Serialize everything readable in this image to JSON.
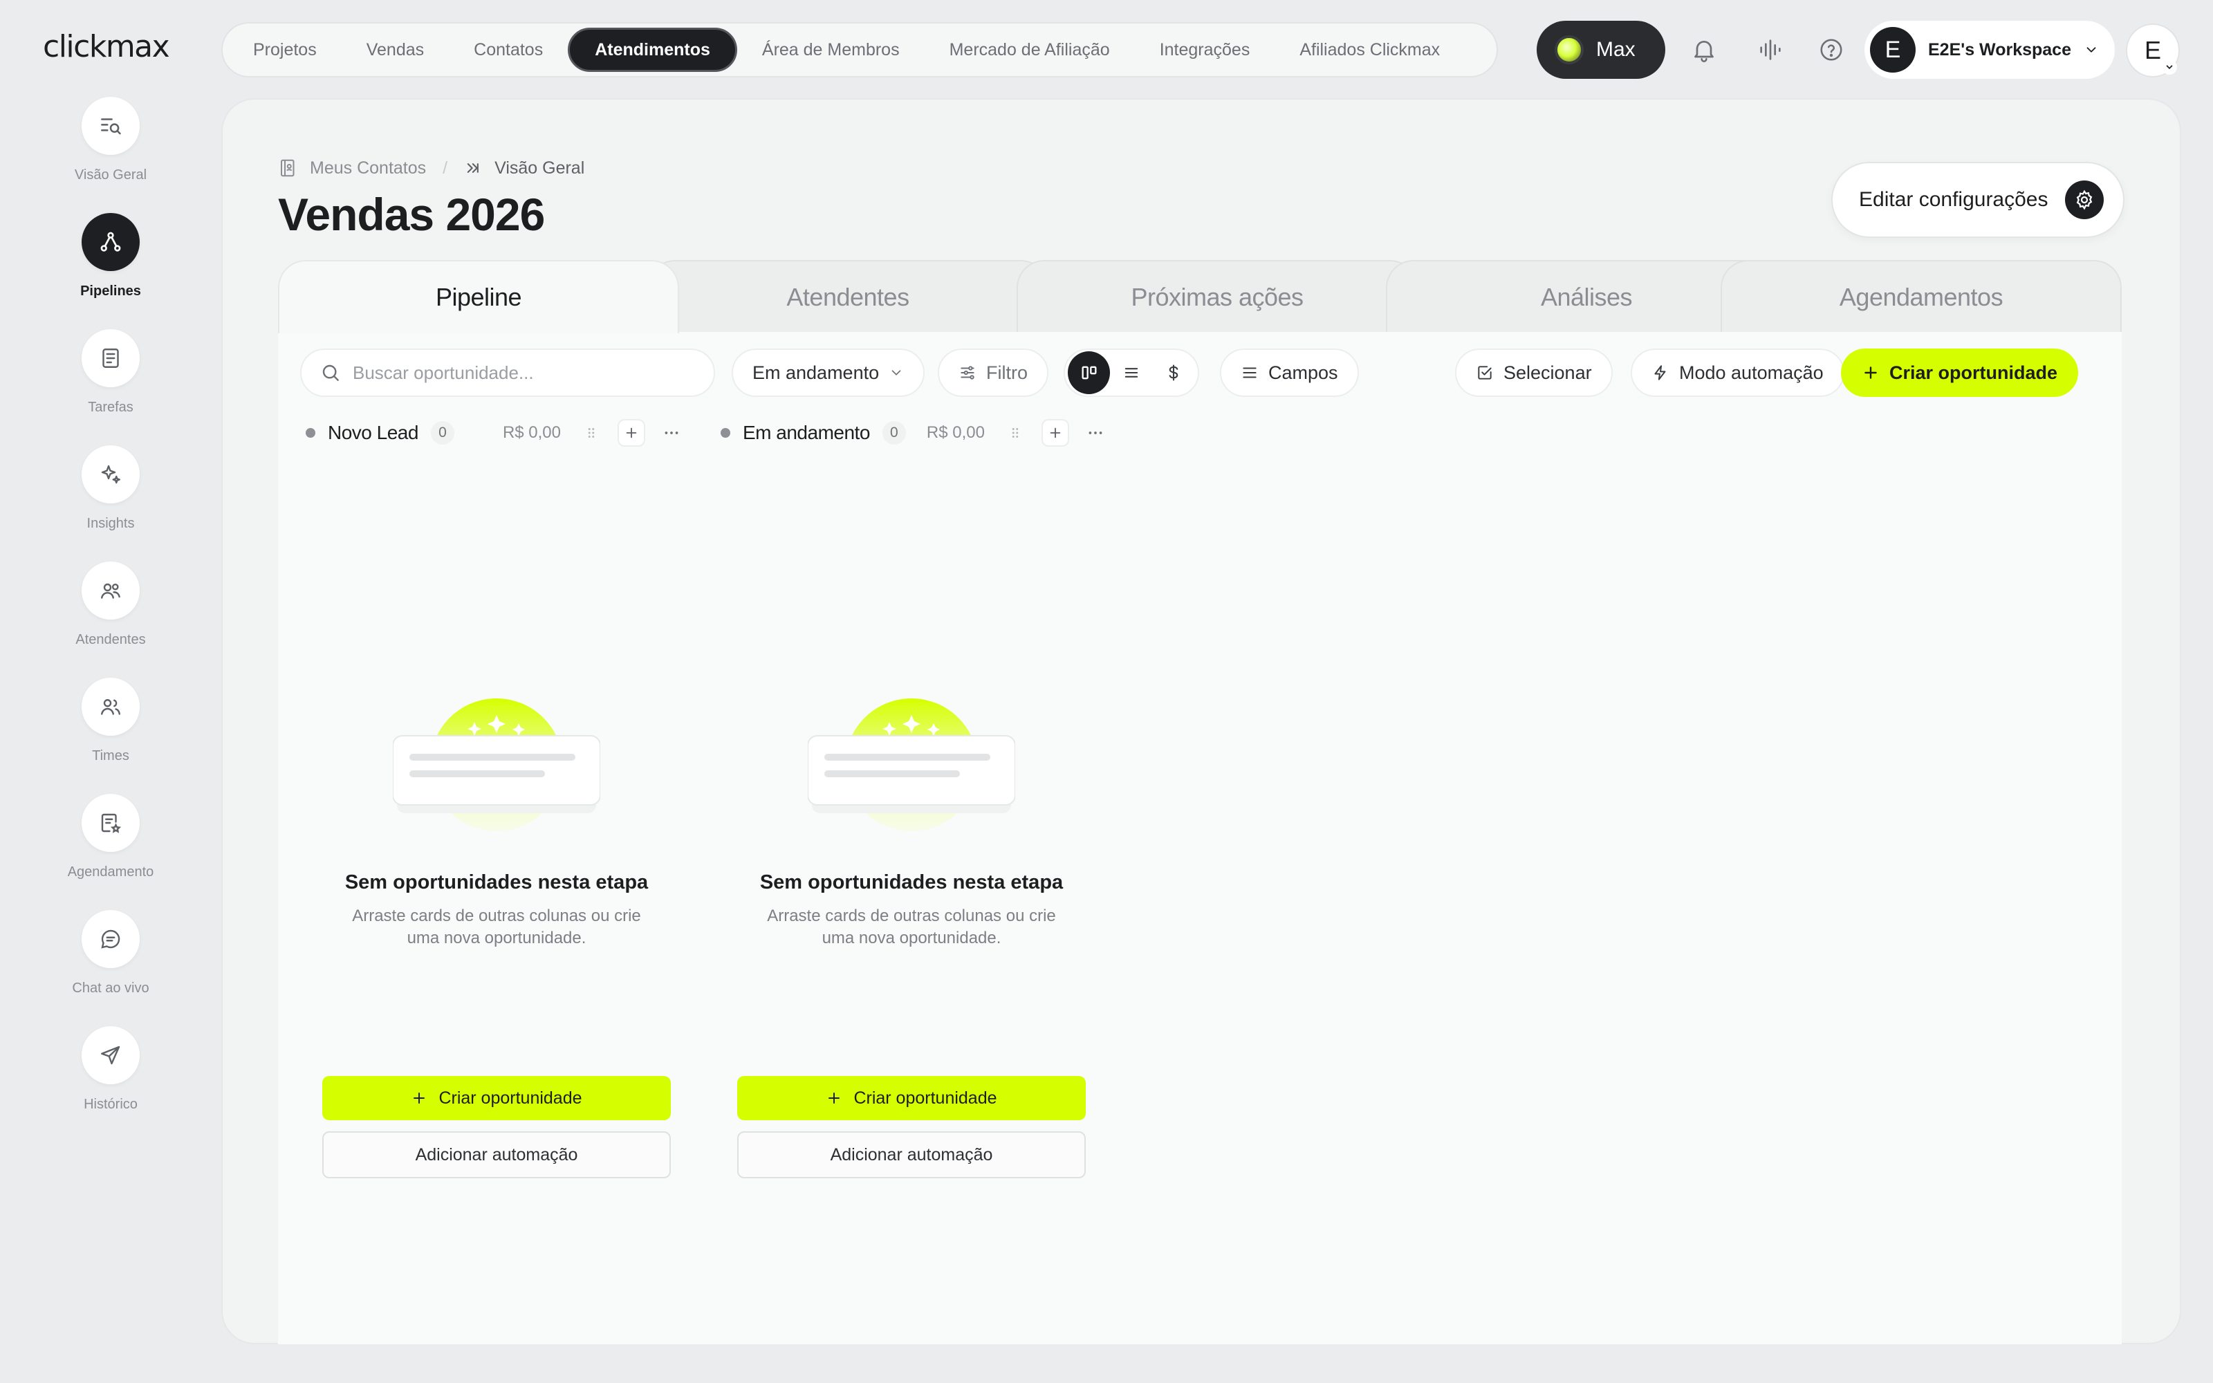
{
  "brand": {
    "logo": "clickmax",
    "accent": "#d5ff00",
    "dark": "#1d1f22"
  },
  "topnav": {
    "items": [
      {
        "label": "Projetos",
        "active": false
      },
      {
        "label": "Vendas",
        "active": false
      },
      {
        "label": "Contatos",
        "active": false
      },
      {
        "label": "Atendimentos",
        "active": true
      },
      {
        "label": "Área de Membros",
        "active": false
      },
      {
        "label": "Mercado de Afiliação",
        "active": false
      },
      {
        "label": "Integrações",
        "active": false
      },
      {
        "label": "Afiliados Clickmax",
        "active": false
      }
    ],
    "max_label": "Max",
    "icons": [
      "bell-icon",
      "waveform-icon",
      "help-icon"
    ],
    "workspace": {
      "initial": "E",
      "name": "E2E's Workspace"
    },
    "user_initial": "E"
  },
  "sidebar": {
    "items": [
      {
        "label": "Visão Geral",
        "icon": "overview-search-icon",
        "active": false
      },
      {
        "label": "Pipelines",
        "icon": "pipeline-icon",
        "active": true
      },
      {
        "label": "Tarefas",
        "icon": "tasks-icon",
        "active": false
      },
      {
        "label": "Insights",
        "icon": "sparkles-icon",
        "active": false
      },
      {
        "label": "Atendentes",
        "icon": "agents-icon",
        "active": false
      },
      {
        "label": "Times",
        "icon": "teams-icon",
        "active": false
      },
      {
        "label": "Agendamento",
        "icon": "schedule-icon",
        "active": false
      },
      {
        "label": "Chat ao vivo",
        "icon": "chat-icon",
        "active": false
      },
      {
        "label": "Histórico",
        "icon": "send-icon",
        "active": false
      }
    ]
  },
  "breadcrumb": {
    "parent": "Meus Contatos",
    "separator": "/",
    "current": "Visão Geral"
  },
  "page": {
    "title": "Vendas 2026",
    "edit_label": "Editar configurações"
  },
  "tabs": [
    {
      "label": "Pipeline",
      "active": true
    },
    {
      "label": "Atendentes",
      "active": false
    },
    {
      "label": "Próximas ações",
      "active": false
    },
    {
      "label": "Análises",
      "active": false
    },
    {
      "label": "Agendamentos",
      "active": false
    }
  ],
  "toolbar": {
    "search_placeholder": "Buscar oportunidade...",
    "status_label": "Em andamento",
    "filter_label": "Filtro",
    "view_modes": [
      "kanban-icon",
      "list-icon",
      "dollar-icon"
    ],
    "fields_label": "Campos",
    "select_label": "Selecionar",
    "automation_label": "Modo automação",
    "create_label": "Criar oportunidade"
  },
  "columns": [
    {
      "title": "Novo Lead",
      "count": "0",
      "amount": "R$ 0,00",
      "empty_title": "Sem oportunidades nesta etapa",
      "empty_desc": "Arraste cards de outras colunas ou crie uma nova oportunidade.",
      "create_label": "Criar oportunidade",
      "automation_label": "Adicionar automação"
    },
    {
      "title": "Em andamento",
      "count": "0",
      "amount": "R$ 0,00",
      "empty_title": "Sem oportunidades nesta etapa",
      "empty_desc": "Arraste cards de outras colunas ou crie uma nova oportunidade.",
      "create_label": "Criar oportunidade",
      "automation_label": "Adicionar automação"
    }
  ]
}
